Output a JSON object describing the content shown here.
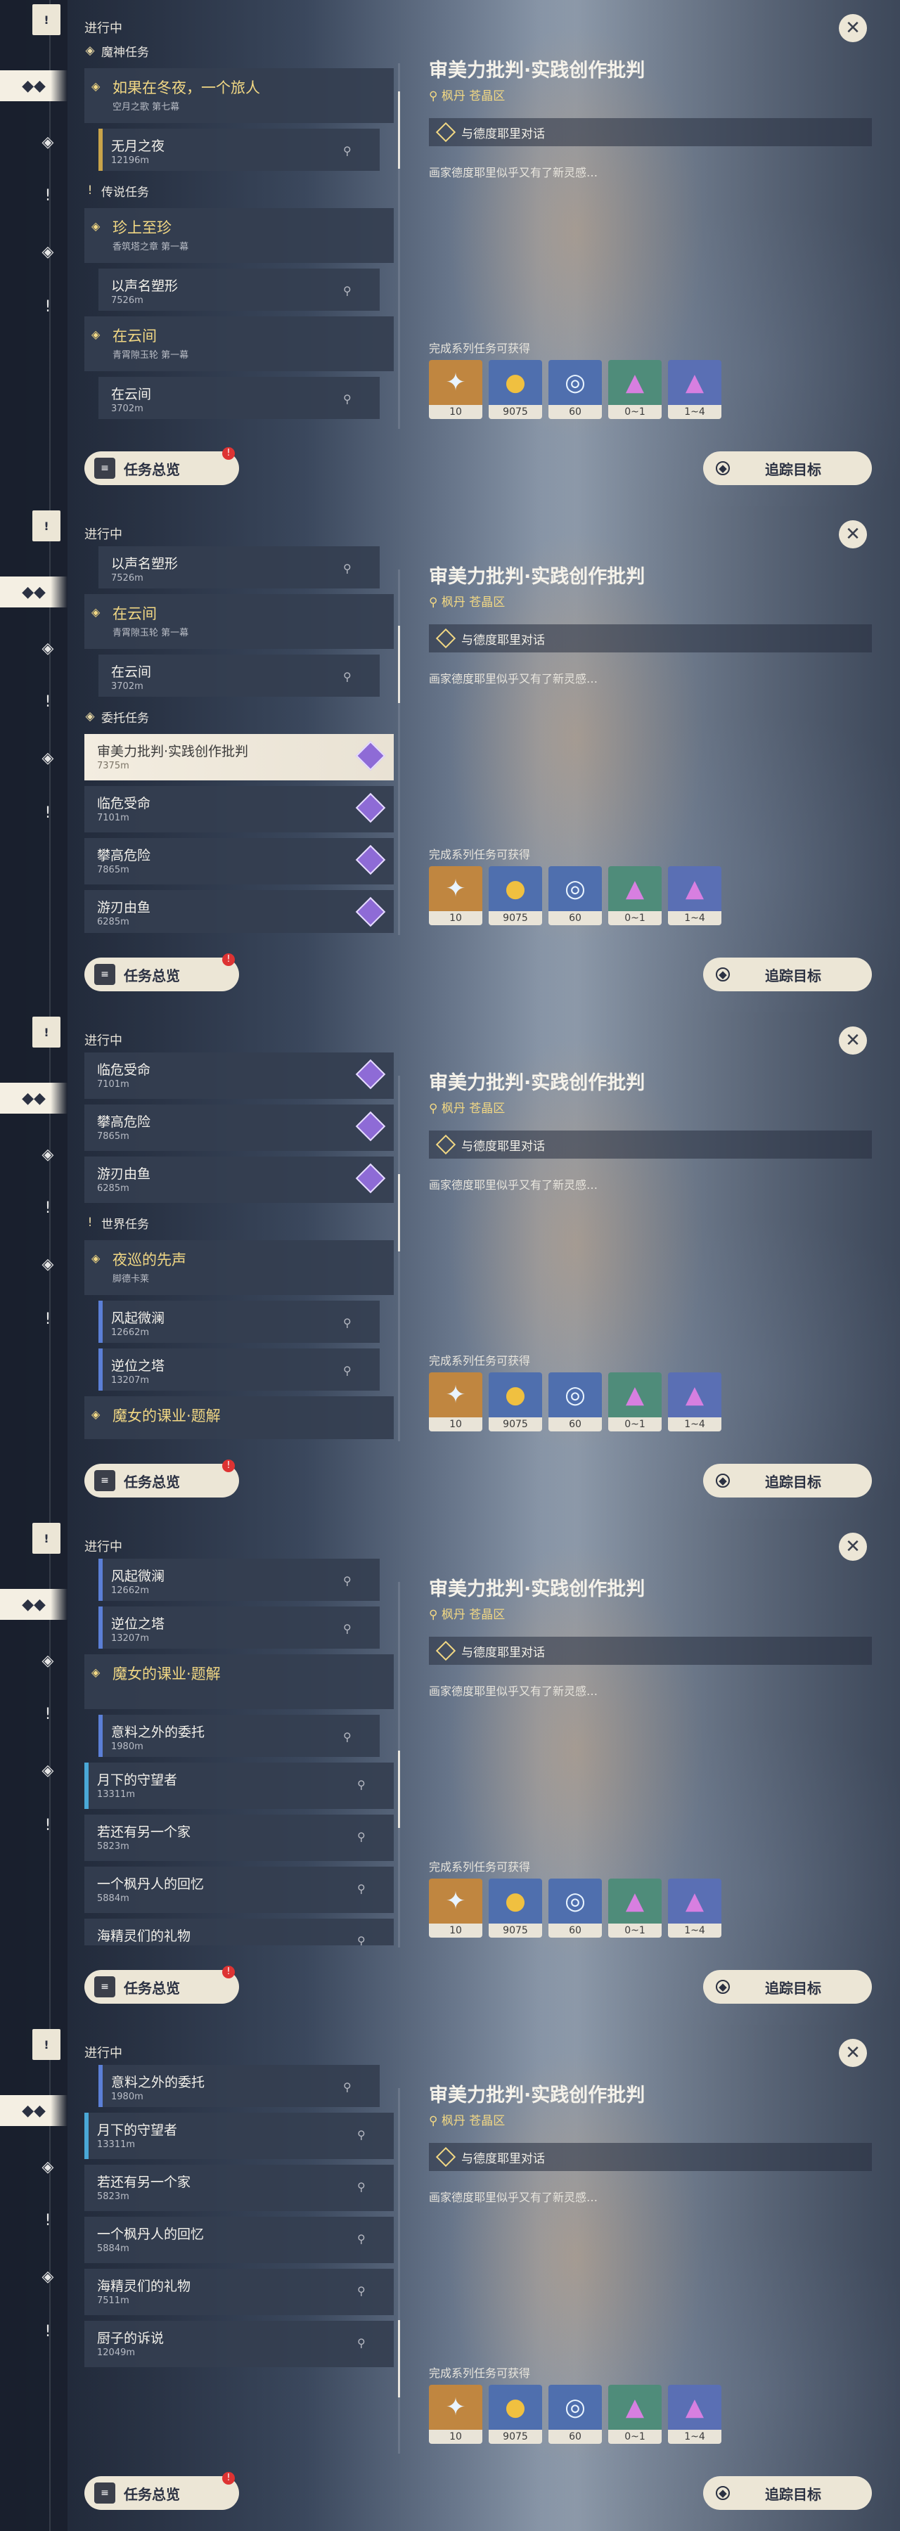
{
  "common": {
    "in_progress_label": "进行中",
    "quest_title": "审美力批判·实践创作批判",
    "location": "枫丹 苍晶区",
    "dialog_label": "与德度耶里对话",
    "description": "画家德度耶里似乎又有了新灵感…",
    "rewards_header": "完成系列任务可获得",
    "rewards": [
      {
        "icon": "star-crystal-icon",
        "count": "10",
        "color": "#c08640"
      },
      {
        "icon": "mora-coin-icon",
        "count": "9075",
        "color": "#4f6fae"
      },
      {
        "icon": "experience-icon",
        "count": "60",
        "color": "#4f6fae"
      },
      {
        "icon": "crystal-ore-icon",
        "count": "0~1",
        "color": "#4f8c7a"
      },
      {
        "icon": "purple-crystal-icon",
        "count": "1~4",
        "color": "#5a6fb4"
      }
    ],
    "overview_button": "任务总览",
    "track_button": "追踪目标",
    "close_symbol": "✕",
    "badge": "!"
  },
  "panels": [
    {
      "items": [
        {
          "kind": "header",
          "label": "魔神任务",
          "mark": "◈"
        },
        {
          "kind": "group",
          "title": "如果在冬夜，一个旅人",
          "sub": "空月之歌 第七幕",
          "gold": true
        },
        {
          "kind": "sub",
          "title": "无月之夜",
          "sub": "12196m",
          "bar": "#c9a44a"
        },
        {
          "kind": "header",
          "label": "传说任务",
          "mark": "!"
        },
        {
          "kind": "group",
          "title": "珍上至珍",
          "sub": "香筑塔之章 第一幕"
        },
        {
          "kind": "sub",
          "title": "以声名塑形",
          "sub": "7526m"
        },
        {
          "kind": "group",
          "title": "在云间",
          "sub": "青霄隙玉轮 第一幕"
        },
        {
          "kind": "sub",
          "title": "在云间",
          "sub": "3702m"
        }
      ]
    },
    {
      "items": [
        {
          "kind": "sub",
          "title": "以声名塑形",
          "sub": "7526m"
        },
        {
          "kind": "group",
          "title": "在云间",
          "sub": "青霄隙玉轮 第一幕"
        },
        {
          "kind": "sub",
          "title": "在云间",
          "sub": "3702m"
        },
        {
          "kind": "header",
          "label": "委托任务",
          "mark": "◈"
        },
        {
          "kind": "row",
          "title": "审美力批判·实践创作批判",
          "sub": "7375m",
          "selected": true,
          "star": true
        },
        {
          "kind": "row",
          "title": "临危受命",
          "sub": "7101m",
          "star": true
        },
        {
          "kind": "row",
          "title": "攀高危险",
          "sub": "7865m",
          "star": true
        },
        {
          "kind": "row",
          "title": "游刃由鱼",
          "sub": "6285m",
          "star": true
        }
      ]
    },
    {
      "items": [
        {
          "kind": "row",
          "title": "临危受命",
          "sub": "7101m",
          "star": true
        },
        {
          "kind": "row",
          "title": "攀高危险",
          "sub": "7865m",
          "star": true
        },
        {
          "kind": "row",
          "title": "游刃由鱼",
          "sub": "6285m",
          "star": true
        },
        {
          "kind": "header",
          "label": "世界任务",
          "mark": "!"
        },
        {
          "kind": "group",
          "title": "夜巡的先声",
          "sub": "脚德卡莱"
        },
        {
          "kind": "sub",
          "title": "风起微澜",
          "sub": "12662m",
          "bar": "#5b7fd6"
        },
        {
          "kind": "sub",
          "title": "逆位之塔",
          "sub": "13207m",
          "bar": "#5b7fd6"
        },
        {
          "kind": "group",
          "title": "魔女的课业·题解",
          "sub": ""
        }
      ]
    },
    {
      "items": [
        {
          "kind": "sub",
          "title": "风起微澜",
          "sub": "12662m",
          "bar": "#5b7fd6"
        },
        {
          "kind": "sub",
          "title": "逆位之塔",
          "sub": "13207m",
          "bar": "#5b7fd6"
        },
        {
          "kind": "group",
          "title": "魔女的课业·题解",
          "sub": ""
        },
        {
          "kind": "sub",
          "title": "意料之外的委托",
          "sub": "1980m",
          "bar": "#5b7fd6"
        },
        {
          "kind": "row",
          "title": "月下的守望者",
          "sub": "13311m",
          "bar": "#4aa8d6"
        },
        {
          "kind": "row",
          "title": "若还有另一个家",
          "sub": "5823m"
        },
        {
          "kind": "row",
          "title": "一个枫丹人的回忆",
          "sub": "5884m"
        },
        {
          "kind": "row",
          "title": "海精灵们的礼物",
          "sub": "7511m"
        }
      ]
    },
    {
      "items": [
        {
          "kind": "sub",
          "title": "意料之外的委托",
          "sub": "1980m",
          "bar": "#5b7fd6"
        },
        {
          "kind": "row",
          "title": "月下的守望者",
          "sub": "13311m",
          "bar": "#4aa8d6"
        },
        {
          "kind": "row",
          "title": "若还有另一个家",
          "sub": "5823m"
        },
        {
          "kind": "row",
          "title": "一个枫丹人的回忆",
          "sub": "5884m"
        },
        {
          "kind": "row",
          "title": "海精灵们的礼物",
          "sub": "7511m"
        },
        {
          "kind": "row",
          "title": "厨子的诉说",
          "sub": "12049m"
        }
      ]
    }
  ]
}
